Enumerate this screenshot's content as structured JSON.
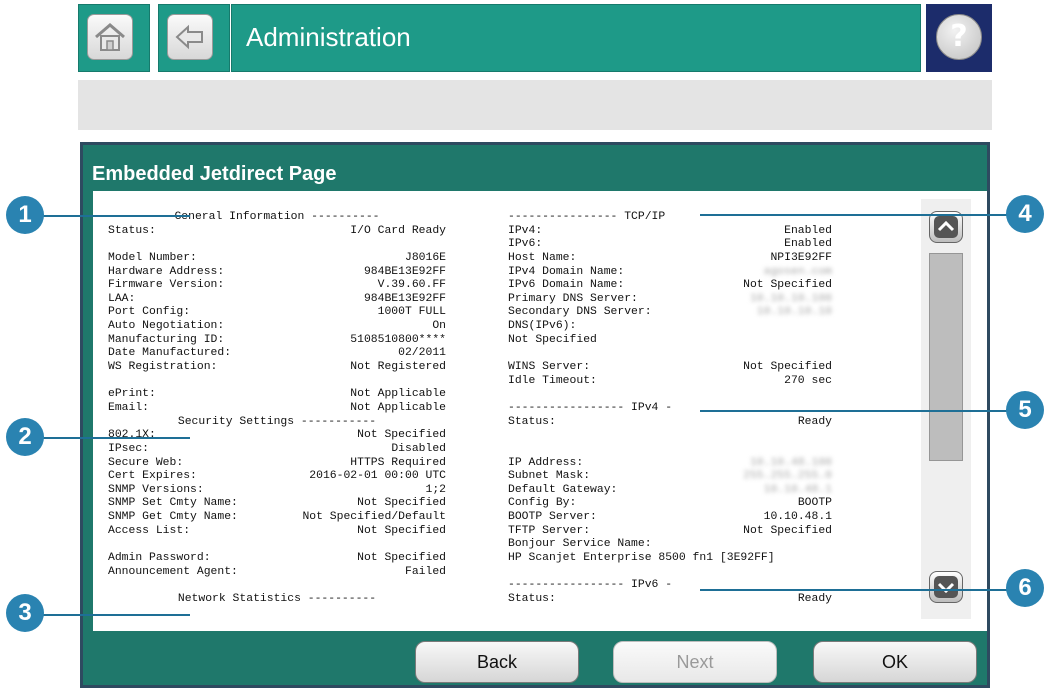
{
  "header": {
    "title": "Administration",
    "help_glyph": "?",
    "icons": {
      "home": "home-icon",
      "back": "back-arrow-icon",
      "help": "help-icon"
    }
  },
  "panel": {
    "title": "Embedded Jetdirect Page"
  },
  "general": {
    "heading": "General Information ----------",
    "rows": [
      {
        "k": "Status:",
        "v": "I/O Card Ready"
      },
      {
        "k": "",
        "v": ""
      },
      {
        "k": "Model Number:",
        "v": "J8016E"
      },
      {
        "k": "Hardware Address:",
        "v": "984BE13E92FF"
      },
      {
        "k": "Firmware Version:",
        "v": "V.39.60.FF"
      },
      {
        "k": "LAA:",
        "v": "984BE13E92FF"
      },
      {
        "k": "Port Config:",
        "v": "1000T FULL"
      },
      {
        "k": "Auto Negotiation:",
        "v": "On"
      },
      {
        "k": "Manufacturing ID:",
        "v": "5108510800****"
      },
      {
        "k": "Date Manufactured:",
        "v": "02/2011"
      },
      {
        "k": "WS Registration:",
        "v": "Not Registered"
      },
      {
        "k": "",
        "v": ""
      },
      {
        "k": "ePrint:",
        "v": "Not Applicable"
      },
      {
        "k": "Email:",
        "v": "Not Applicable"
      }
    ]
  },
  "security": {
    "heading": "Security Settings -----------",
    "rows": [
      {
        "k": "802.1X:",
        "v": "Not Specified"
      },
      {
        "k": "IPsec:",
        "v": "Disabled"
      },
      {
        "k": "Secure Web:",
        "v": "HTTPS Required"
      },
      {
        "k": "Cert Expires:",
        "v": "2016-02-01 00:00 UTC"
      },
      {
        "k": "SNMP Versions:",
        "v": "1;2"
      },
      {
        "k": "SNMP Set Cmty Name:",
        "v": "Not Specified"
      },
      {
        "k": "SNMP Get Cmty Name:",
        "v": "Not Specified/Default"
      },
      {
        "k": "Access List:",
        "v": "Not Specified"
      },
      {
        "k": "",
        "v": ""
      },
      {
        "k": "Admin Password:",
        "v": "Not Specified"
      },
      {
        "k": "Announcement Agent:",
        "v": "Failed"
      }
    ]
  },
  "network_stats": {
    "heading": "Network Statistics ----------"
  },
  "tcpip": {
    "heading": "---------------- TCP/IP",
    "rows": [
      {
        "k": "IPv4:",
        "v": "Enabled"
      },
      {
        "k": "IPv6:",
        "v": "Enabled"
      },
      {
        "k": "Host Name:",
        "v": "NPI3E92FF"
      },
      {
        "k": "IPv4 Domain Name:",
        "v": "agosen.com",
        "blur": true
      },
      {
        "k": "IPv6 Domain Name:",
        "v": "Not Specified"
      },
      {
        "k": "Primary DNS Server:",
        "v": "10.10.10.100",
        "blur": true
      },
      {
        "k": "Secondary DNS Server:",
        "v": "10.10.10.10",
        "blur": true
      },
      {
        "k": "DNS(IPv6):",
        "v": ""
      },
      {
        "k": "Not Specified",
        "v": ""
      },
      {
        "k": "",
        "v": ""
      },
      {
        "k": "WINS Server:",
        "v": "Not Specified"
      },
      {
        "k": "Idle Timeout:",
        "v": "270 sec"
      }
    ]
  },
  "ipv4": {
    "heading": "----------------- IPv4 -",
    "rows": [
      {
        "k": "Status:",
        "v": "Ready"
      },
      {
        "k": "",
        "v": ""
      },
      {
        "k": "",
        "v": ""
      },
      {
        "k": "IP Address:",
        "v": "10.10.48.100",
        "blur": true
      },
      {
        "k": "Subnet Mask:",
        "v": "255.255.255.0",
        "blur": true
      },
      {
        "k": "Default Gateway:",
        "v": "10.10.48.1",
        "blur": true
      },
      {
        "k": "Config By:",
        "v": "BOOTP"
      },
      {
        "k": "BOOTP Server:",
        "v": "10.10.48.1"
      },
      {
        "k": "TFTP Server:",
        "v": "Not Specified"
      },
      {
        "k": "Bonjour Service Name:",
        "v": ""
      },
      {
        "k": "HP Scanjet Enterprise 8500 fn1 [3E92FF]",
        "v": ""
      }
    ]
  },
  "ipv6": {
    "heading": "----------------- IPv6 -",
    "rows": [
      {
        "k": "Status:",
        "v": "Ready"
      }
    ]
  },
  "scrollbar": {
    "up_glyph": "^",
    "down_glyph": "v",
    "icons": {
      "up": "scroll-up-icon",
      "down": "scroll-down-icon"
    }
  },
  "buttons": {
    "back": "Back",
    "next": "Next",
    "ok": "OK"
  },
  "callouts": [
    "1",
    "2",
    "3",
    "4",
    "5",
    "6"
  ],
  "colors": {
    "header_teal": "#1e9a88",
    "panel_teal": "#1f786b",
    "help_navy": "#1c2c6b",
    "callout_blue": "#2a83b1"
  }
}
